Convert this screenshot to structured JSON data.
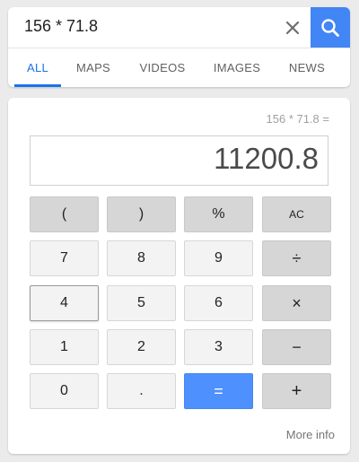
{
  "search": {
    "query": "156 * 71.8",
    "clear_icon": "close-icon",
    "search_icon": "magnifier-icon"
  },
  "tabs": [
    {
      "label": "ALL",
      "active": true
    },
    {
      "label": "MAPS",
      "active": false
    },
    {
      "label": "VIDEOS",
      "active": false
    },
    {
      "label": "IMAGES",
      "active": false
    },
    {
      "label": "NEWS",
      "active": false
    }
  ],
  "calculator": {
    "expression": "156 * 71.8 =",
    "result": "11200.8",
    "keys": {
      "open_paren": "(",
      "close_paren": ")",
      "percent": "%",
      "all_clear": "AC",
      "seven": "7",
      "eight": "8",
      "nine": "9",
      "divide": "÷",
      "four": "4",
      "five": "5",
      "six": "6",
      "multiply": "×",
      "one": "1",
      "two": "2",
      "three": "3",
      "minus": "−",
      "zero": "0",
      "decimal": ".",
      "equals": "=",
      "plus": "+"
    },
    "more_info": "More info"
  },
  "colors": {
    "accent": "#1a73e8",
    "search_button": "#4285f4",
    "equals_button": "#4d90fe",
    "function_key": "#d6d6d6",
    "digit_key": "#f3f3f3"
  }
}
